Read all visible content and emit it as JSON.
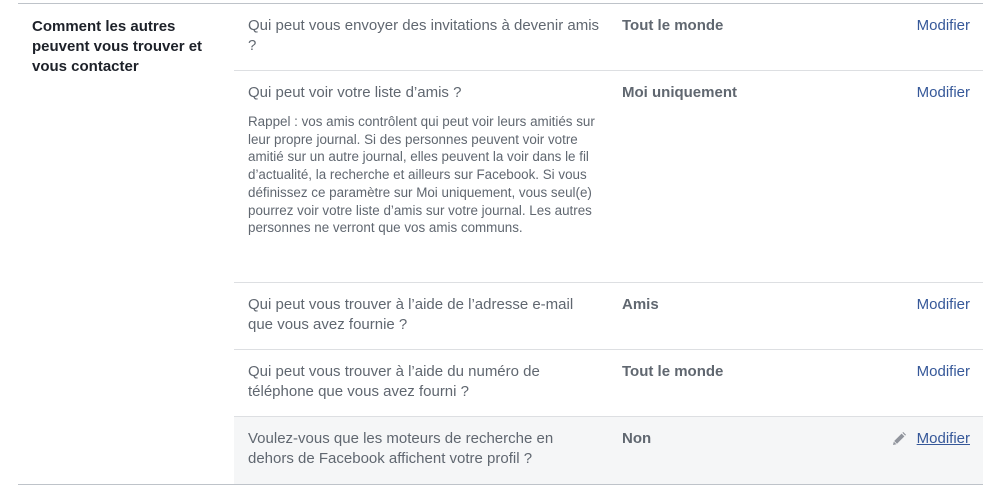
{
  "section": {
    "title": "Comment les autres peuvent vous trouver et vous contacter"
  },
  "rows": [
    {
      "question": "Qui peut vous envoyer des invitations à devenir amis ?",
      "value": "Tout le monde",
      "action": "Modifier"
    },
    {
      "question": "Qui peut voir votre liste d’amis ?",
      "note": "Rappel : vos amis contrôlent qui peut voir leurs amitiés sur leur propre journal. Si des personnes peuvent voir votre amitié sur un autre journal, elles peuvent la voir dans le fil d’actualité, la recherche et ailleurs sur Facebook. Si vous définissez ce paramètre sur Moi uniquement, vous seul(e) pourrez voir votre liste d’amis sur votre journal. Les autres personnes ne verront que vos amis communs.",
      "value": "Moi uniquement",
      "action": "Modifier"
    },
    {
      "question": "Qui peut vous trouver à l’aide de l’adresse e-mail que vous avez fournie ?",
      "value": "Amis",
      "action": "Modifier"
    },
    {
      "question": "Qui peut vous trouver à l’aide du numéro de téléphone que vous avez fourni ?",
      "value": "Tout le monde",
      "action": "Modifier"
    },
    {
      "question": "Voulez-vous que les moteurs de recherche en dehors de Facebook affichent votre profil ?",
      "value": "Non",
      "action": "Modifier",
      "icon": "pencil-icon"
    }
  ],
  "colors": {
    "link": "#365899",
    "muted_text": "#606770",
    "hover_row": "#f5f6f7"
  }
}
